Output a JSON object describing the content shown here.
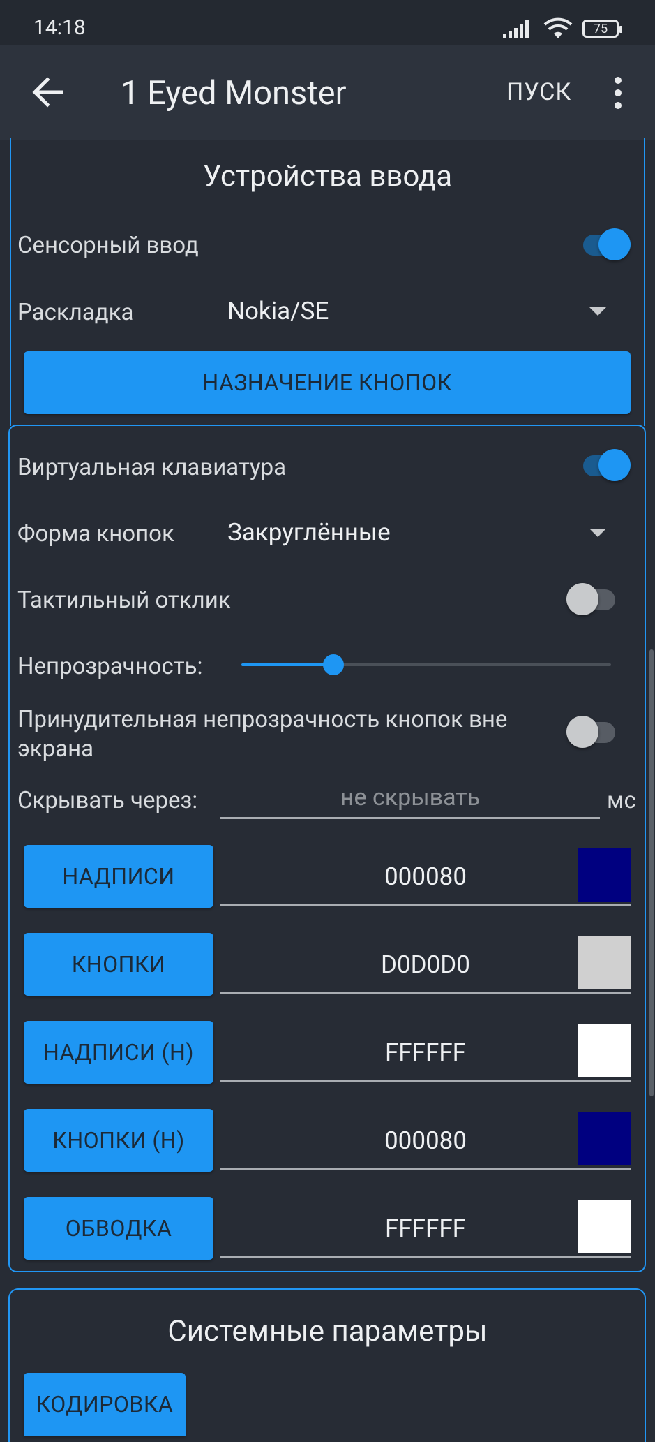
{
  "status": {
    "time": "14:18",
    "battery": "75"
  },
  "appbar": {
    "title": "1 Eyed Monster",
    "start": "ПУСК"
  },
  "input_devices": {
    "title": "Устройства ввода",
    "touch_label": "Сенсорный ввод",
    "touch_on": true,
    "layout_label": "Раскладка",
    "layout_value": "Nokia/SE",
    "assign_button": "НАЗНАЧЕНИЕ КНОПОК"
  },
  "virtual_keyboard": {
    "label": "Виртуальная клавиатура",
    "on": true,
    "shape_label": "Форма кнопок",
    "shape_value": "Закруглённые",
    "haptic_label": "Тактильный отклик",
    "haptic_on": false,
    "opacity_label": "Непрозрачность:",
    "opacity_fraction": 0.2,
    "force_opacity_label_line1": "Принудительная непрозрачность кнопок вне",
    "force_opacity_label_line2": "экрана",
    "force_opacity_on": false,
    "hide_label": "Скрывать через:",
    "hide_placeholder": "не скрывать",
    "hide_unit": "мс",
    "colors": [
      {
        "button": "НАДПИСИ",
        "hex": "000080",
        "swatch": "#000080"
      },
      {
        "button": "КНОПКИ",
        "hex": "D0D0D0",
        "swatch": "#D0D0D0"
      },
      {
        "button": "НАДПИСИ (Н)",
        "hex": "FFFFFF",
        "swatch": "#FFFFFF"
      },
      {
        "button": "КНОПКИ (Н)",
        "hex": "000080",
        "swatch": "#000080"
      },
      {
        "button": "ОБВОДКА",
        "hex": "FFFFFF",
        "swatch": "#FFFFFF"
      }
    ]
  },
  "system_params": {
    "title": "Системные параметры",
    "encoding_button": "КОДИРОВКА"
  },
  "theme": {
    "accent": "#1e96f3",
    "background": "#272c35",
    "appbar": "#2d333d"
  }
}
